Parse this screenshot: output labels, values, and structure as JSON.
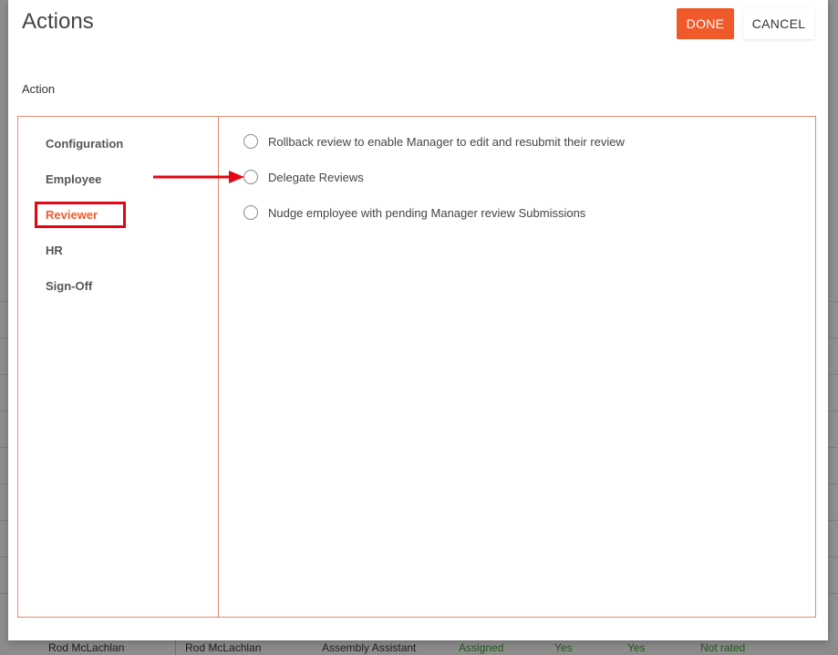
{
  "modal": {
    "title": "Actions",
    "done_label": "DONE",
    "cancel_label": "CANCEL",
    "action_label": "Action"
  },
  "categories": [
    {
      "label": "Configuration",
      "active": false
    },
    {
      "label": "Employee",
      "active": false
    },
    {
      "label": "Reviewer",
      "active": true
    },
    {
      "label": "HR",
      "active": false
    },
    {
      "label": "Sign-Off",
      "active": false
    }
  ],
  "options": [
    {
      "label": "Rollback review to enable Manager to edit and resubmit their review",
      "selected": false
    },
    {
      "label": "Delegate Reviews",
      "selected": false
    },
    {
      "label": "Nudge employee with pending Manager review Submissions",
      "selected": false
    }
  ],
  "background_row": {
    "employee": "Rod McLachlan",
    "manager": "Rod McLachlan",
    "position": "Assembly Assistant",
    "status": "Assigned",
    "col_a": "Yes",
    "col_b": "Yes",
    "rating": "Not rated"
  },
  "colors": {
    "accent": "#f05a2b",
    "panel_border": "#e08a6a",
    "annotation_red": "#e30613"
  }
}
